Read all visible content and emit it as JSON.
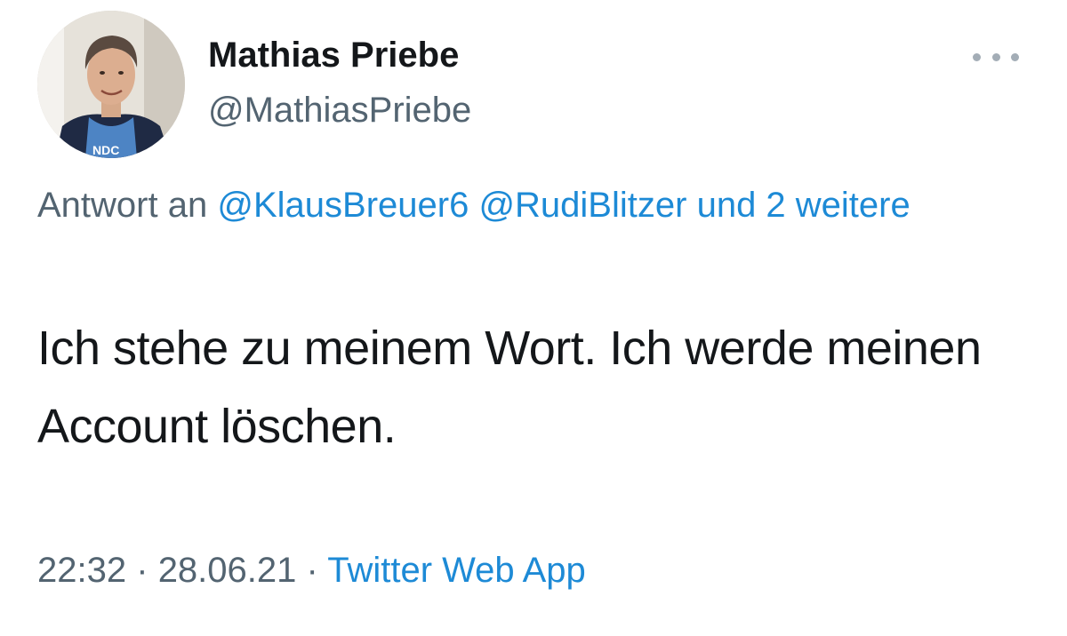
{
  "author": {
    "display_name": "Mathias Priebe",
    "handle": "@MathiasPriebe"
  },
  "more_menu": {
    "icon": "more-horizontal-icon"
  },
  "reply_context": {
    "prefix": "Antwort an",
    "mentions": [
      "@KlausBreuer6",
      "@RudiBlitzer"
    ],
    "others": "und 2 weitere"
  },
  "tweet": {
    "text": "Ich stehe zu meinem Wort. Ich werde meinen Account löschen."
  },
  "meta": {
    "time": "22:32",
    "separator": "·",
    "date": "28.06.21",
    "source": "Twitter Web App"
  },
  "colors": {
    "link": "#1d8ad6",
    "secondary_text": "#536471",
    "primary_text": "#14171a"
  }
}
